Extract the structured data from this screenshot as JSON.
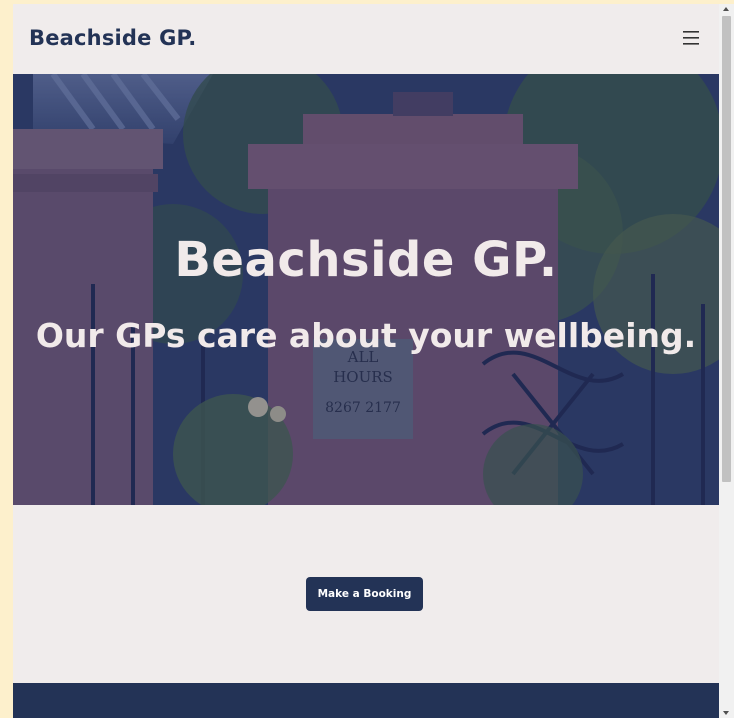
{
  "header": {
    "brand": "Beachside GP.",
    "menu_icon": "hamburger-menu-icon"
  },
  "hero": {
    "title": "Beachside GP.",
    "subtitle": "Our GPs care about your wellbeing.",
    "sign_line1": "ALL",
    "sign_line2": "HOURS",
    "sign_phone": "8267 2177"
  },
  "cta": {
    "booking_label": "Make a Booking"
  },
  "colors": {
    "brand_navy": "#233356",
    "page_bg": "#f0ecec",
    "outer_bg": "#fdf0cc"
  }
}
